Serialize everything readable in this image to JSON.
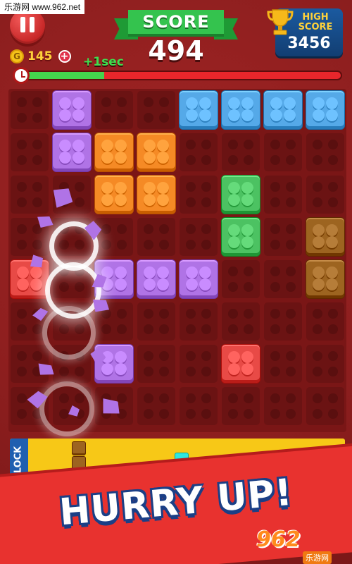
{
  "watermark": {
    "text": "乐游网 www.962.net"
  },
  "hud": {
    "pause_icon": "pause-icon",
    "coins": 145,
    "add_coins_label": "+",
    "score_label": "SCORE",
    "score_value": 494,
    "high_score_label": "HIGH SCORE",
    "high_score_value": 3456,
    "time_bonus": "+1sec",
    "timer_remaining_fraction": 0.25
  },
  "colors": {
    "purple": "#b073e6",
    "orange": "#f58a25",
    "blue": "#55a9e8",
    "green": "#4cc262",
    "brown": "#9d6420",
    "red": "#e84a46",
    "cyan": "#2fe6e0"
  },
  "board": {
    "rows": 8,
    "cols": 8,
    "bricks": [
      {
        "r": 0,
        "c": 1,
        "color": "purple"
      },
      {
        "r": 0,
        "c": 4,
        "color": "blue"
      },
      {
        "r": 0,
        "c": 5,
        "color": "blue"
      },
      {
        "r": 0,
        "c": 6,
        "color": "blue"
      },
      {
        "r": 0,
        "c": 7,
        "color": "blue"
      },
      {
        "r": 1,
        "c": 1,
        "color": "purple"
      },
      {
        "r": 1,
        "c": 2,
        "color": "orange"
      },
      {
        "r": 1,
        "c": 3,
        "color": "orange"
      },
      {
        "r": 2,
        "c": 2,
        "color": "orange"
      },
      {
        "r": 2,
        "c": 3,
        "color": "orange"
      },
      {
        "r": 2,
        "c": 5,
        "color": "green"
      },
      {
        "r": 3,
        "c": 5,
        "color": "green"
      },
      {
        "r": 3,
        "c": 7,
        "color": "brown"
      },
      {
        "r": 4,
        "c": 0,
        "color": "red"
      },
      {
        "r": 4,
        "c": 2,
        "color": "purple"
      },
      {
        "r": 4,
        "c": 3,
        "color": "purple"
      },
      {
        "r": 4,
        "c": 4,
        "color": "purple"
      },
      {
        "r": 4,
        "c": 7,
        "color": "brown"
      },
      {
        "r": 6,
        "c": 2,
        "color": "purple"
      },
      {
        "r": 6,
        "c": 5,
        "color": "red"
      }
    ]
  },
  "tray": {
    "label": "UR BLOCK",
    "pieces": [
      {
        "color": "brown",
        "cells": [
          [
            0,
            0
          ],
          [
            1,
            0
          ],
          [
            2,
            0
          ]
        ]
      },
      {
        "color": "cyan",
        "cells": [
          [
            0,
            0
          ]
        ]
      }
    ]
  },
  "banner": {
    "text": "HURRY UP!"
  },
  "logo": {
    "main": "962",
    "sub": "乐游网"
  }
}
